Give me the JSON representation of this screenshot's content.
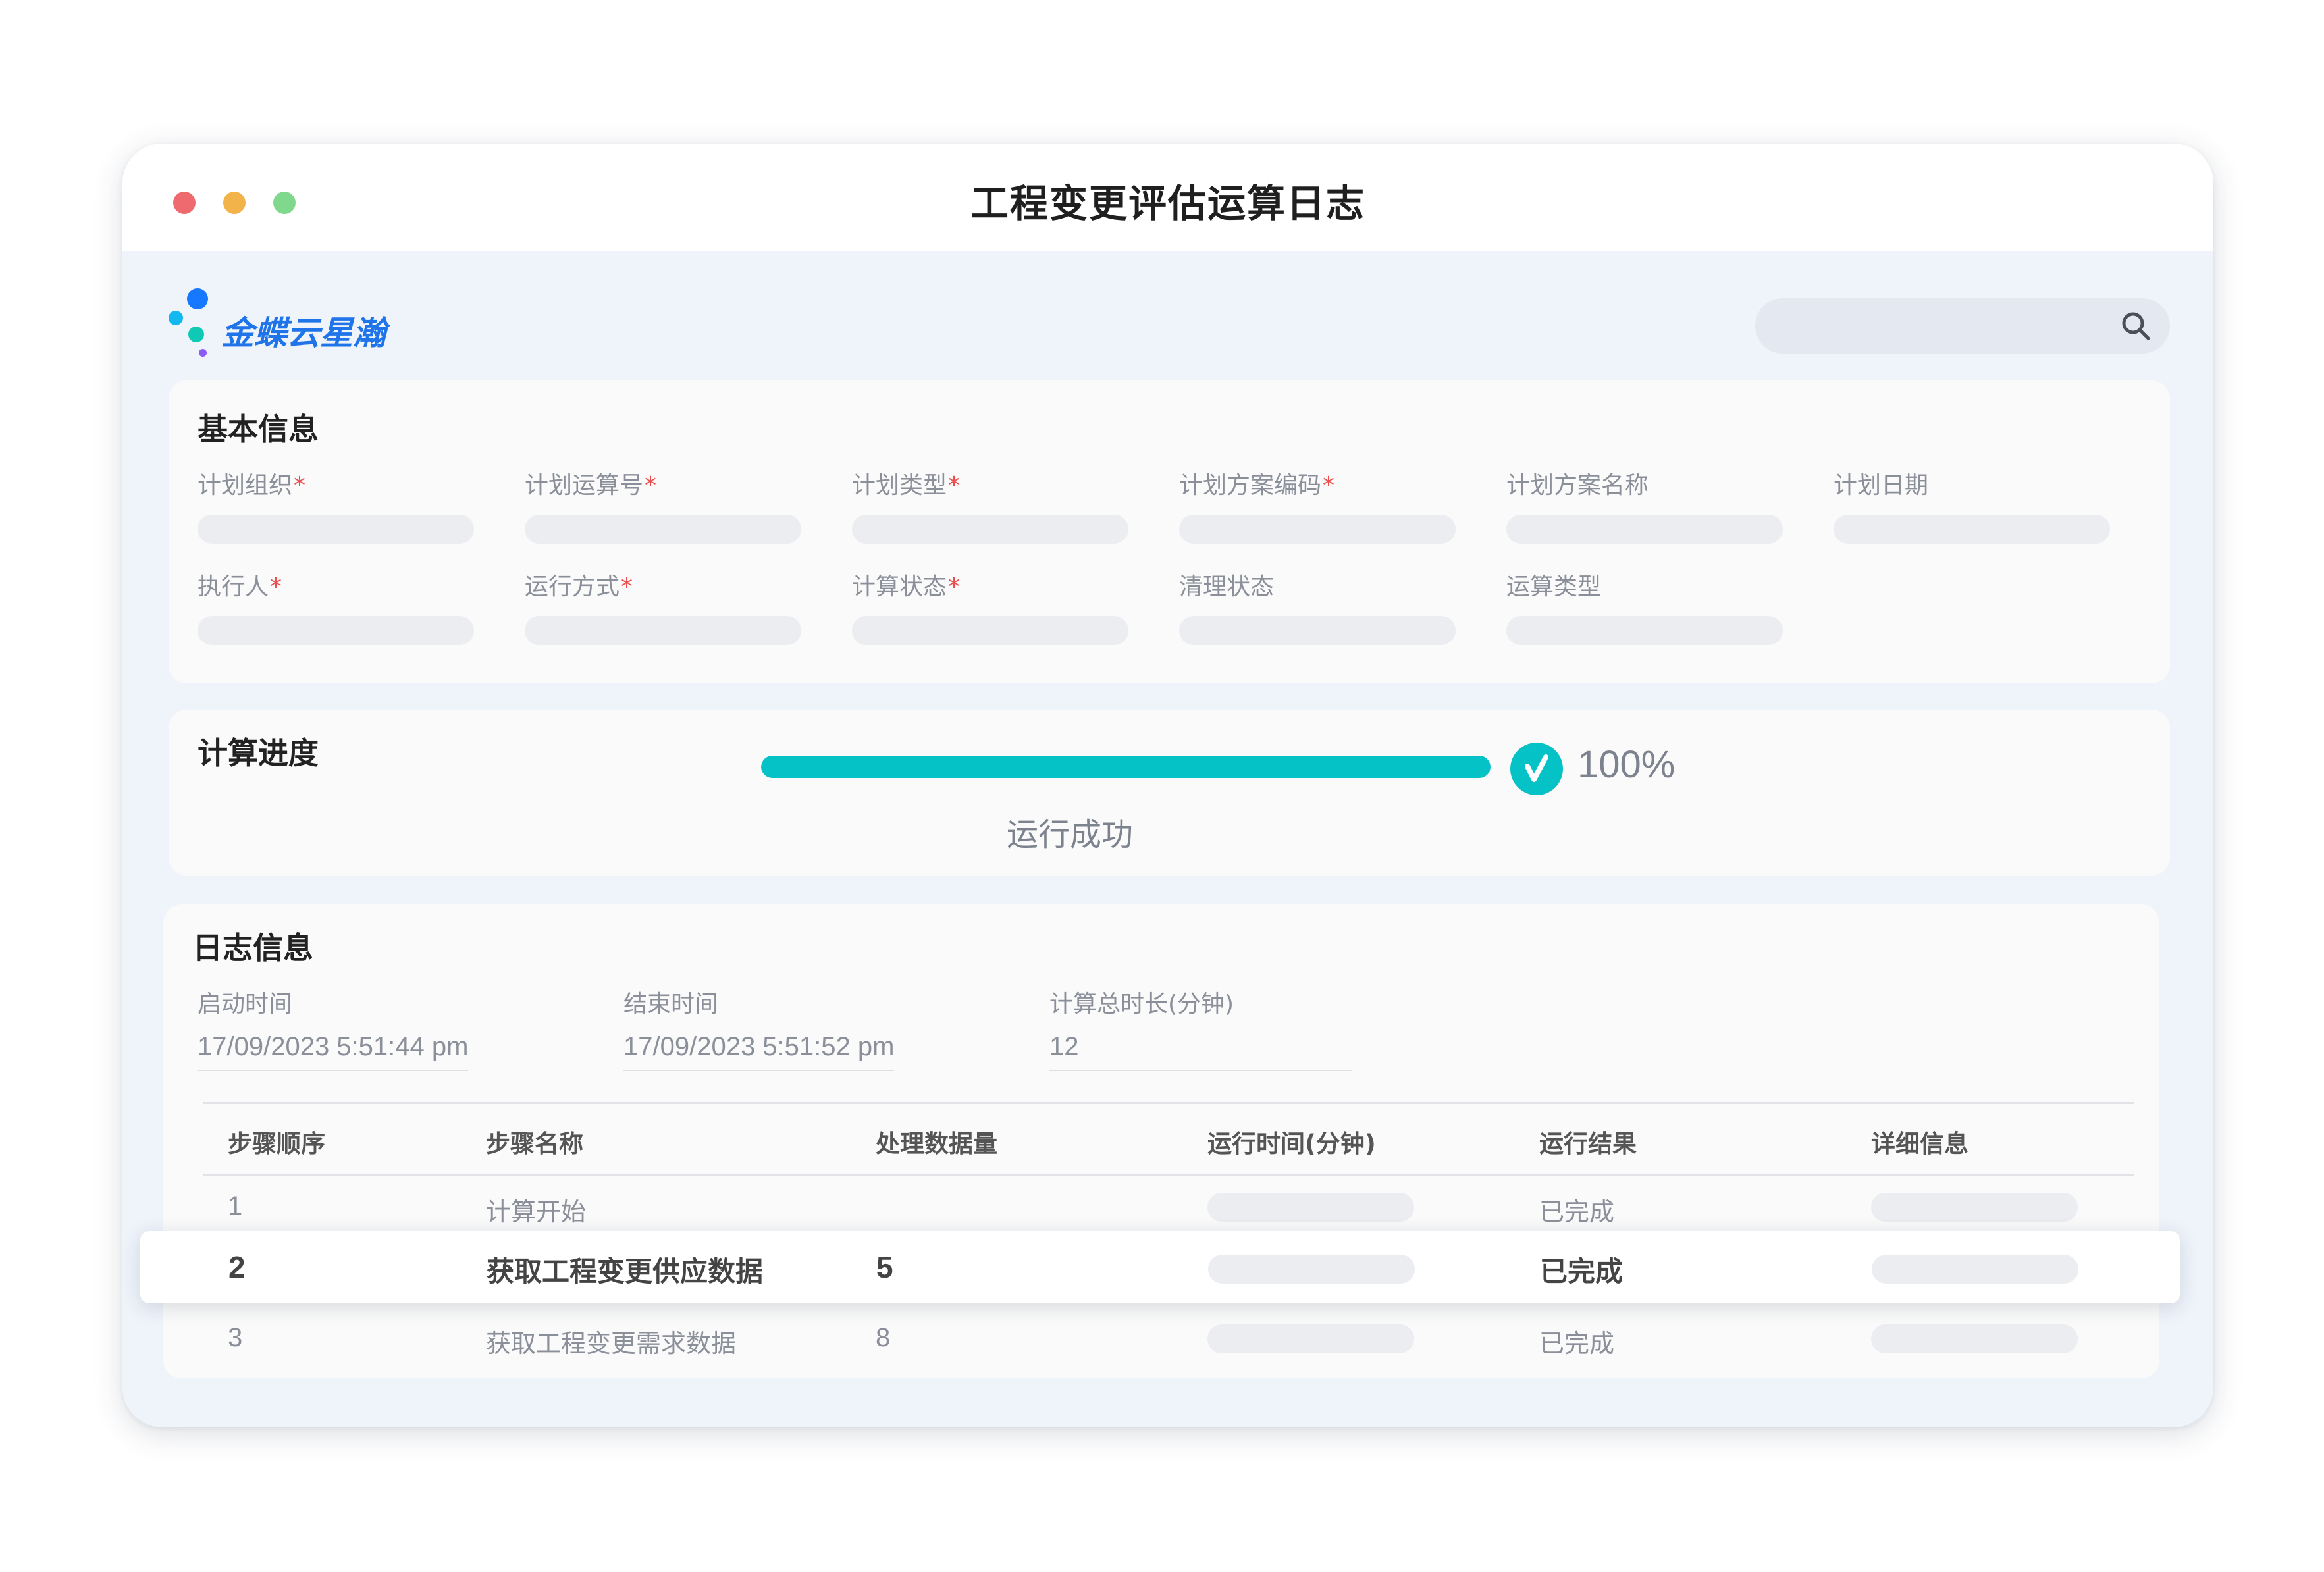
{
  "window": {
    "title": "工程变更评估运算日志"
  },
  "brand": {
    "name": "金蝶云星瀚"
  },
  "search": {
    "value": "",
    "placeholder": ""
  },
  "basic_info": {
    "title": "基本信息",
    "fields": [
      {
        "label": "计划组织",
        "required": "*"
      },
      {
        "label": "计划运算号",
        "required": "*"
      },
      {
        "label": "计划类型",
        "required": "*"
      },
      {
        "label": "计划方案编码",
        "required": "*"
      },
      {
        "label": "计划方案名称",
        "required": ""
      },
      {
        "label": "计划日期",
        "required": ""
      },
      {
        "label": "执行人",
        "required": "*"
      },
      {
        "label": "运行方式",
        "required": "*"
      },
      {
        "label": "计算状态",
        "required": "*"
      },
      {
        "label": "清理状态",
        "required": ""
      },
      {
        "label": "运算类型",
        "required": ""
      }
    ]
  },
  "progress": {
    "title": "计算进度",
    "percent_value": 100,
    "percent_label": "100%",
    "status": "运行成功",
    "check_glyph": "√"
  },
  "log_info": {
    "title": "日志信息",
    "start": {
      "label": "启动时间",
      "value": "17/09/2023 5:51:44 pm"
    },
    "end": {
      "label": "结束时间",
      "value": "17/09/2023 5:51:52 pm"
    },
    "duration": {
      "label": "计算总时长(分钟)",
      "value": "12"
    },
    "columns": [
      "步骤顺序",
      "步骤名称",
      "处理数据量",
      "运行时间(分钟)",
      "运行结果",
      "详细信息"
    ],
    "rows": [
      {
        "seq": "1",
        "name": "计算开始",
        "count": "",
        "result": "已完成"
      },
      {
        "seq": "2",
        "name": "获取工程变更供应数据",
        "count": "5",
        "result": "已完成"
      },
      {
        "seq": "3",
        "name": "获取工程变更需求数据",
        "count": "8",
        "result": "已完成"
      }
    ]
  },
  "colors": {
    "accent": "#05c2c7",
    "brand_blue": "#1e74e8",
    "required": "#ee4d4d",
    "window_bg": "#eff3fa"
  }
}
